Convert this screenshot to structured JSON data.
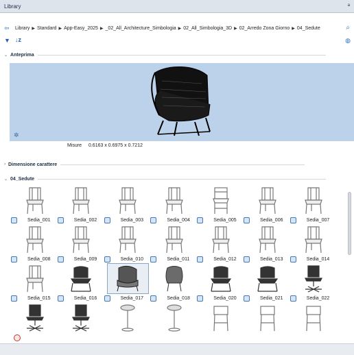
{
  "window": {
    "title": "Library",
    "pin_glyph": "ᵃ"
  },
  "breadcrumb": {
    "items": [
      "Library",
      "Standard",
      "App-Easy_2025",
      "_02_All_Architecture_Simbologia",
      "02_All_Simbologia_3D",
      "02_Arredo Zona Giorno",
      "04_Sedute"
    ]
  },
  "sections": {
    "preview": "Anteprima",
    "dimension": "Dimensione carattere",
    "folder": "04_Sedute"
  },
  "measure": {
    "label": "Misure",
    "value": "0.6163 x 0.6975 x 0.7212"
  },
  "items": [
    {
      "name": "Sedia_001",
      "kind": "chair"
    },
    {
      "name": "Sedia_002",
      "kind": "chair"
    },
    {
      "name": "Sedia_003",
      "kind": "chair"
    },
    {
      "name": "Sedia_004",
      "kind": "chair"
    },
    {
      "name": "Sedia_005",
      "kind": "stool"
    },
    {
      "name": "Sedia_006",
      "kind": "chair"
    },
    {
      "name": "Sedia_007",
      "kind": "chair"
    },
    {
      "name": "Sedia_008",
      "kind": "chair"
    },
    {
      "name": "Sedia_009",
      "kind": "chair"
    },
    {
      "name": "Sedia_010",
      "kind": "chair"
    },
    {
      "name": "Sedia_011",
      "kind": "chair"
    },
    {
      "name": "Sedia_012",
      "kind": "chair"
    },
    {
      "name": "Sedia_013",
      "kind": "chair"
    },
    {
      "name": "Sedia_014",
      "kind": "chair"
    },
    {
      "name": "Sedia_015",
      "kind": "chair"
    },
    {
      "name": "Sedia_016",
      "kind": "dark-chair"
    },
    {
      "name": "Sedia_017",
      "kind": "armchair",
      "selected": true
    },
    {
      "name": "Sedia_018",
      "kind": "shell"
    },
    {
      "name": "Sedia_020",
      "kind": "dark-chair"
    },
    {
      "name": "Sedia_021",
      "kind": "dark-chair"
    },
    {
      "name": "Sedia_022",
      "kind": "office"
    },
    {
      "name": "",
      "kind": "office"
    },
    {
      "name": "",
      "kind": "office"
    },
    {
      "name": "",
      "kind": "round-stool"
    },
    {
      "name": "",
      "kind": "round-stool"
    },
    {
      "name": "",
      "kind": "bar-stool"
    },
    {
      "name": "",
      "kind": "bar-stool"
    },
    {
      "name": "",
      "kind": "bar-stool"
    }
  ],
  "colors": {
    "preview_bg": "#bcd2ea",
    "accent": "#2a6fc0",
    "selection_border": "#8aa4c4"
  }
}
